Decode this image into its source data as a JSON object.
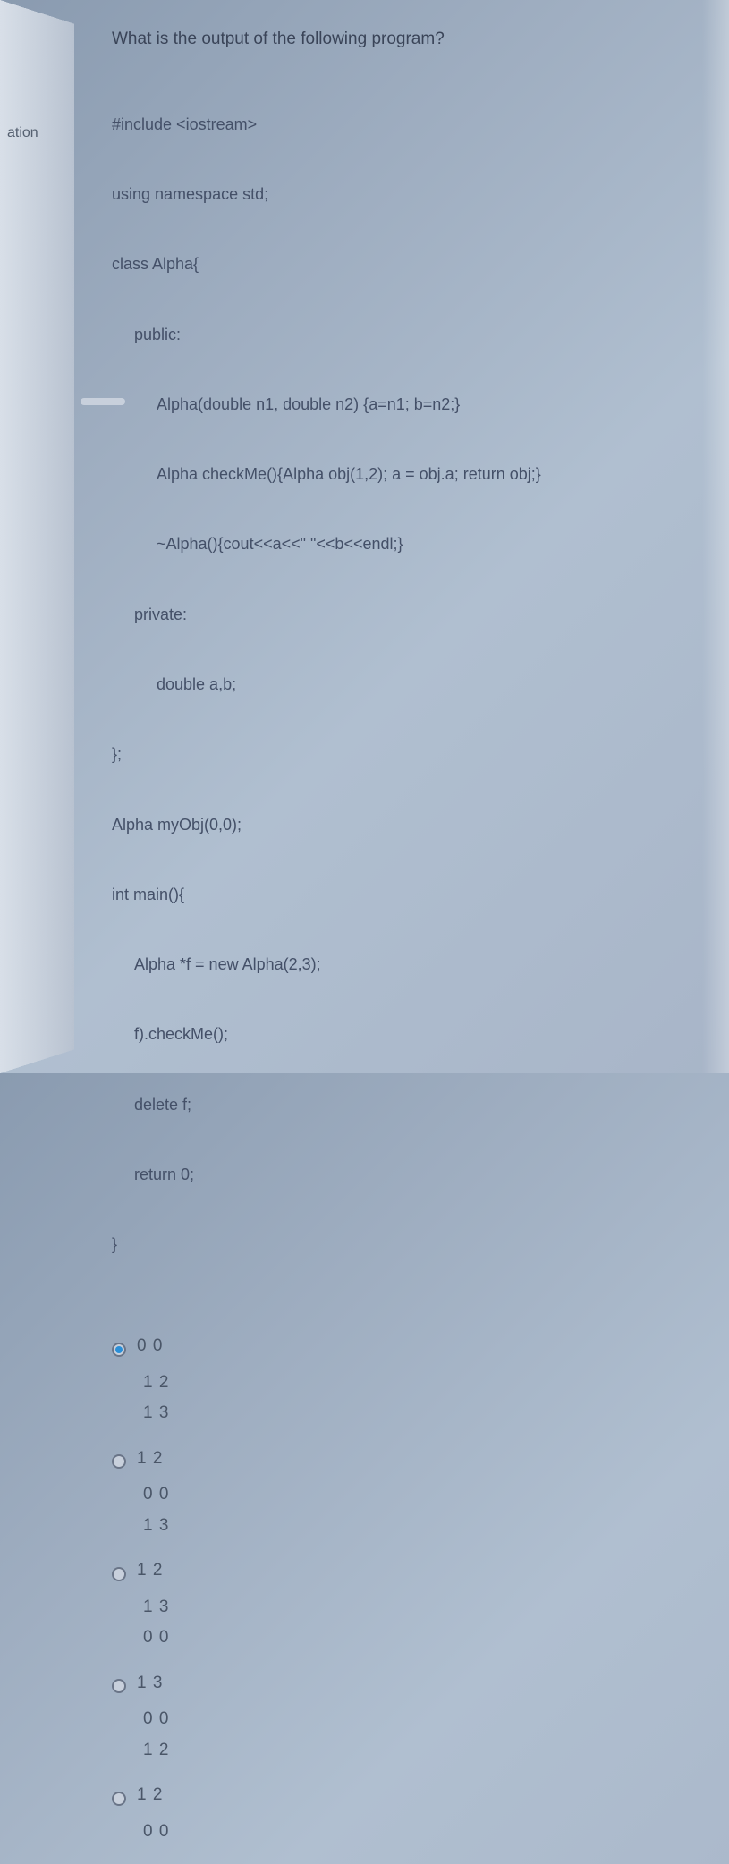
{
  "tab": "ation",
  "question": "What is the output of the following program?",
  "code": {
    "lines": [
      {
        "text": "#include <iostream>",
        "indent": 0
      },
      {
        "text": "using namespace std;",
        "indent": 0
      },
      {
        "text": "class Alpha{",
        "indent": 0
      },
      {
        "text": "public:",
        "indent": 1
      },
      {
        "text": "Alpha(double n1, double n2) {a=n1; b=n2;}",
        "indent": 2
      },
      {
        "text": "Alpha checkMe(){Alpha obj(1,2); a = obj.a; return obj;}",
        "indent": 2
      },
      {
        "text": "~Alpha(){cout<<a<<\" \"<<b<<endl;}",
        "indent": 2
      },
      {
        "text": "private:",
        "indent": 1
      },
      {
        "text": "double a,b;",
        "indent": 2
      },
      {
        "text": "};",
        "indent": 0
      },
      {
        "text": "Alpha myObj(0,0);",
        "indent": 0
      },
      {
        "text": "int main(){",
        "indent": 0
      },
      {
        "text": "Alpha *f = new Alpha(2,3);",
        "indent": 1
      },
      {
        "text": "f).checkMe();",
        "indent": 1
      },
      {
        "text": "delete f;",
        "indent": 1
      },
      {
        "text": "return 0;",
        "indent": 1
      },
      {
        "text": "}",
        "indent": 0
      }
    ]
  },
  "options": [
    {
      "selected": true,
      "lines": [
        "0 0",
        "1 2",
        "1 3"
      ]
    },
    {
      "selected": false,
      "lines": [
        "1 2",
        "0 0",
        "1 3"
      ]
    },
    {
      "selected": false,
      "lines": [
        "1 2",
        "1 3",
        "0 0"
      ]
    },
    {
      "selected": false,
      "lines": [
        "1 3",
        "0 0",
        "1 2"
      ]
    },
    {
      "selected": false,
      "lines": [
        "1 2",
        "0 0"
      ]
    }
  ]
}
